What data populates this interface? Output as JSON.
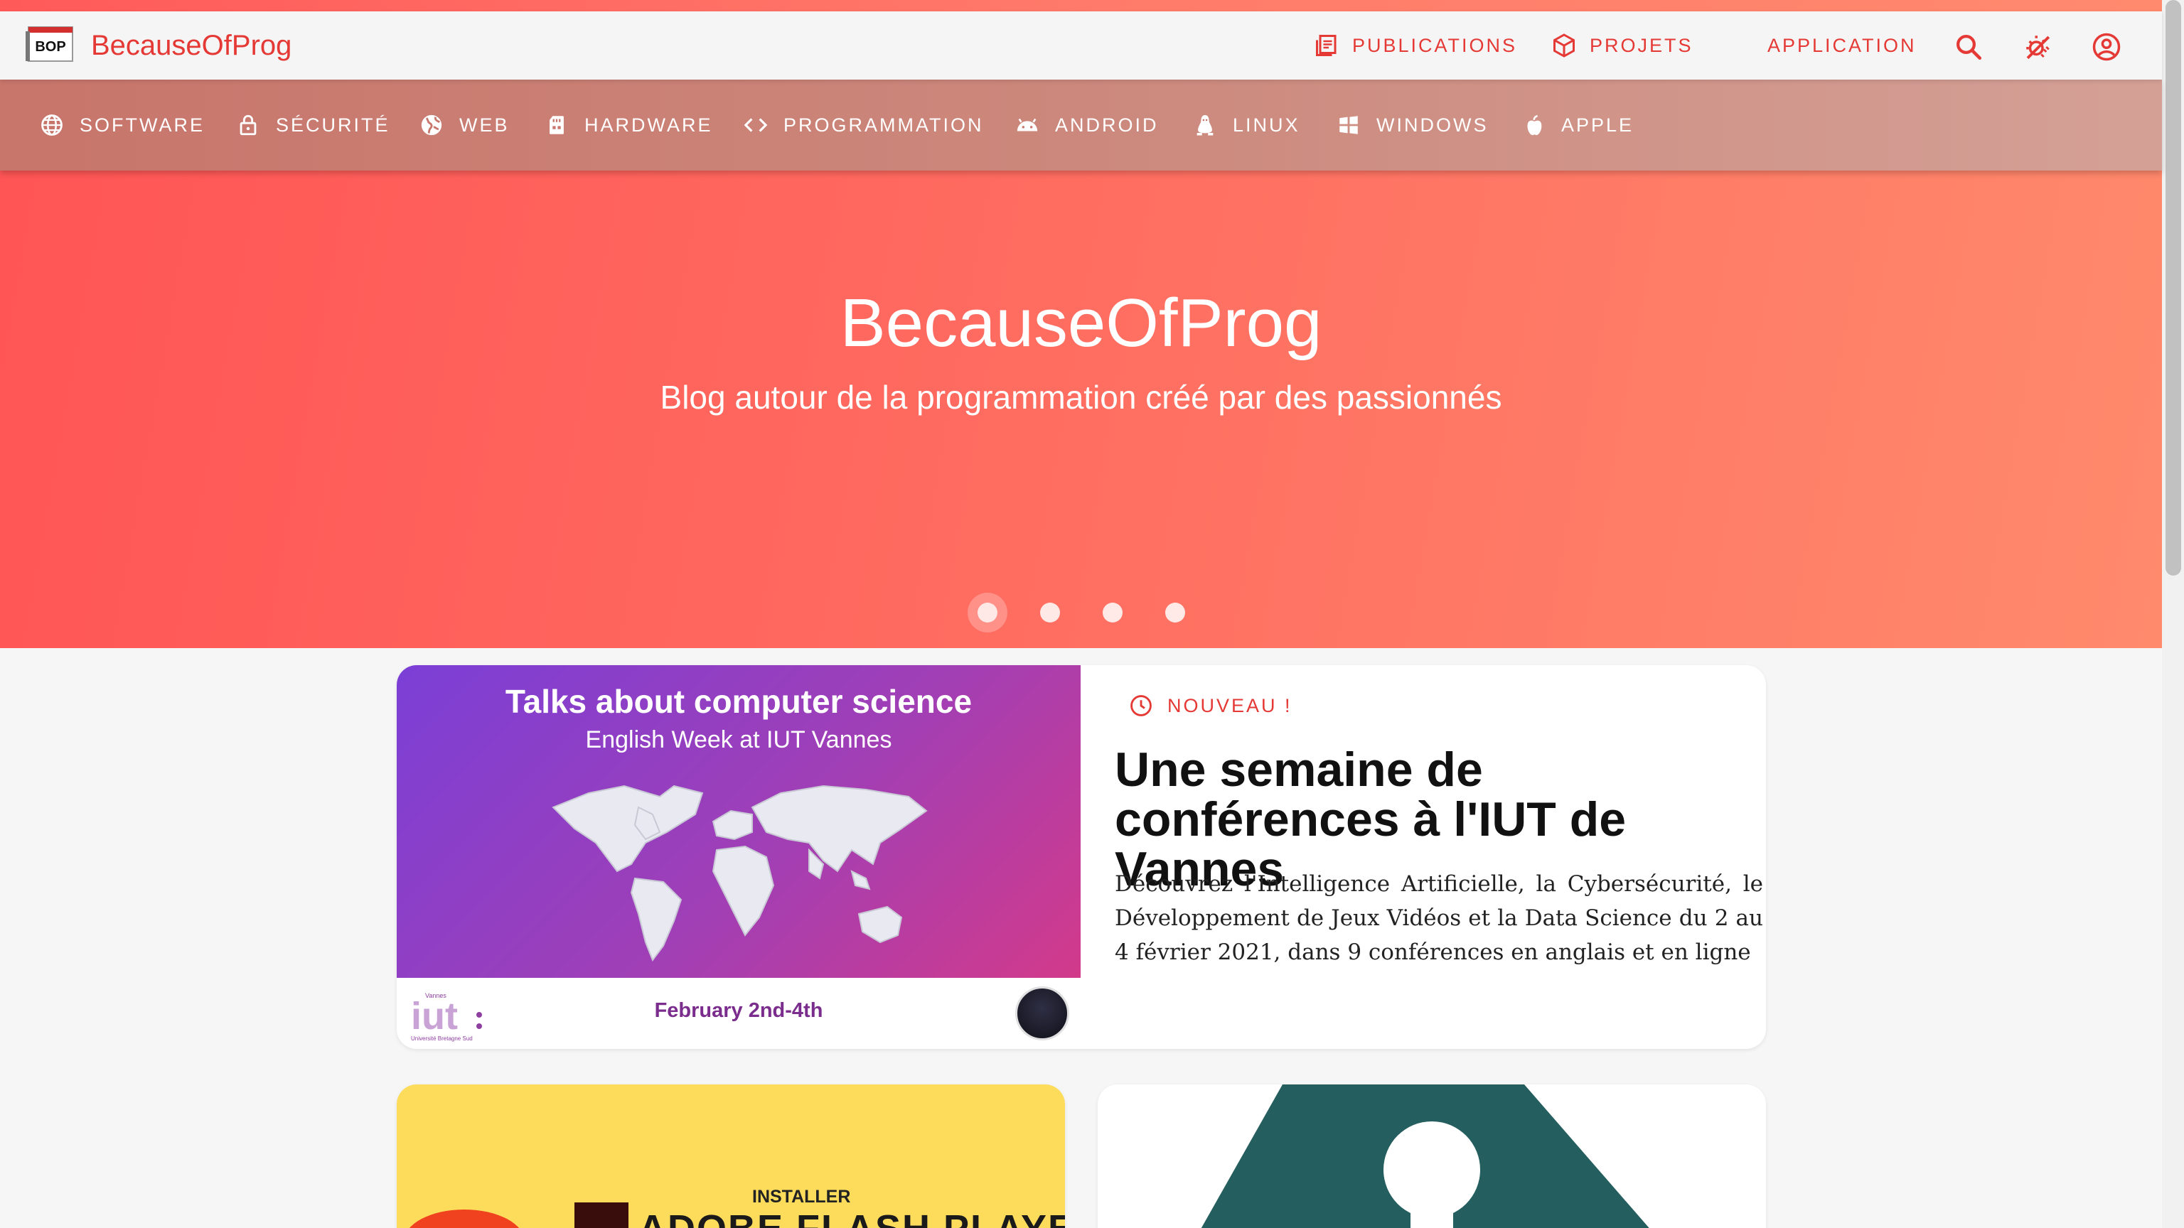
{
  "header": {
    "logo_text": "BOP",
    "brand": "BecauseOfProg",
    "nav": [
      {
        "label": "PUBLICATIONS",
        "icon": "article-icon"
      },
      {
        "label": "PROJETS",
        "icon": "cube-icon"
      },
      {
        "label": "APPLICATION",
        "icon": ""
      }
    ],
    "icons": [
      "search-icon",
      "theme-toggle-icon",
      "account-icon"
    ]
  },
  "categories": [
    {
      "label": "SOFTWARE",
      "icon": "globe-icon"
    },
    {
      "label": "SÉCURITÉ",
      "icon": "lock-icon"
    },
    {
      "label": "WEB",
      "icon": "web-icon"
    },
    {
      "label": "HARDWARE",
      "icon": "chip-icon"
    },
    {
      "label": "PROGRAMMATION",
      "icon": "code-icon"
    },
    {
      "label": "ANDROID",
      "icon": "android-icon"
    },
    {
      "label": "LINUX",
      "icon": "linux-icon"
    },
    {
      "label": "WINDOWS",
      "icon": "windows-icon"
    },
    {
      "label": "APPLE",
      "icon": "apple-icon"
    }
  ],
  "hero": {
    "title": "BecauseOfProg",
    "subtitle": "Blog autour de la programmation créé par des passionnés",
    "slides": 4,
    "active_slide": 0
  },
  "featured": {
    "badge": "NOUVEAU !",
    "title": "Une semaine de conférences à l'IUT de Vannes",
    "description": "Découvrez l'Intelligence Artificielle, la Cybersécurité, le Développement de Jeux Vidéos et la Data Science du 2 au 4 février 2021, dans 9 conférences en anglais et en ligne",
    "image": {
      "title": "Talks about computer science",
      "subtitle": "English Week at IUT Vannes",
      "date": "February 2nd-4th",
      "logo_text": "iut",
      "logo_small_top": "Vannes",
      "logo_small_bottom": "Université Bretagne Sud"
    }
  },
  "cards": [
    {
      "image_small": "INSTALLER",
      "image_big": "ADOBE FLASH PLAYER",
      "color": "#fddc5c"
    },
    {
      "color": "#255e5e"
    }
  ],
  "colors": {
    "accent": "#e53935",
    "hero_start": "#ff5555",
    "hero_end": "#ff8a6c"
  }
}
